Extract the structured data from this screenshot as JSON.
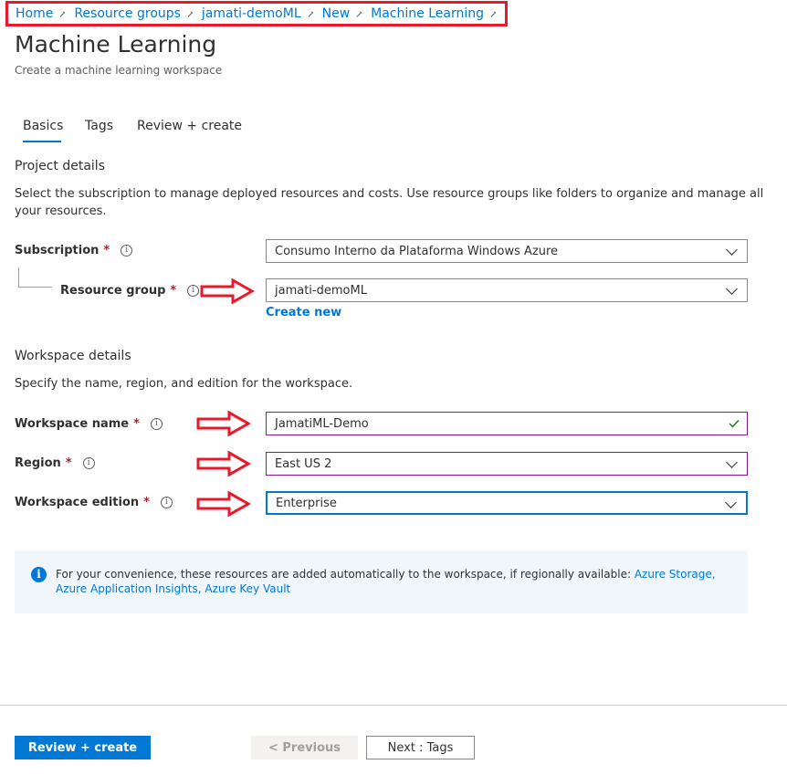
{
  "breadcrumb": [
    "Home",
    "Resource groups",
    "jamati-demoML",
    "New",
    "Machine Learning"
  ],
  "page": {
    "title": "Machine Learning",
    "subtitle": "Create a machine learning workspace"
  },
  "tabs": [
    {
      "label": "Basics",
      "active": true
    },
    {
      "label": "Tags",
      "active": false
    },
    {
      "label": "Review + create",
      "active": false
    }
  ],
  "project": {
    "title": "Project details",
    "description_line1": "Select the subscription to manage deployed resources and costs. Use resource groups like folders to organize and manage all",
    "description_line2": "your resources.",
    "subscription_label": "Subscription",
    "subscription_value": "Consumo Interno da Plataforma Windows Azure",
    "resource_group_label": "Resource group",
    "resource_group_value": "jamati-demoML",
    "create_new": "Create new"
  },
  "workspace": {
    "title": "Workspace details",
    "description": "Specify the name, region, and edition for the workspace.",
    "name_label": "Workspace name",
    "name_value": "JamatiML-Demo",
    "region_label": "Region",
    "region_value": "East US 2",
    "edition_label": "Workspace edition",
    "edition_value": "Enterprise"
  },
  "required_mark": "*",
  "info_glyph": "i",
  "info": {
    "text": "For your convenience, these resources are added automatically to the workspace, if regionally available: ",
    "link1": "Azure Storage",
    "sep1": ", ",
    "link2": "Azure Application Insights",
    "sep2": ", ",
    "link3": "Azure Key Vault"
  },
  "footer": {
    "review_create": "Review + create",
    "previous": "< Previous",
    "next": "Next : Tags"
  },
  "colors": {
    "accent": "#0078d4",
    "annotation_red": "#e8192c",
    "valid_green": "#107c10",
    "focused_border": "#881798"
  }
}
